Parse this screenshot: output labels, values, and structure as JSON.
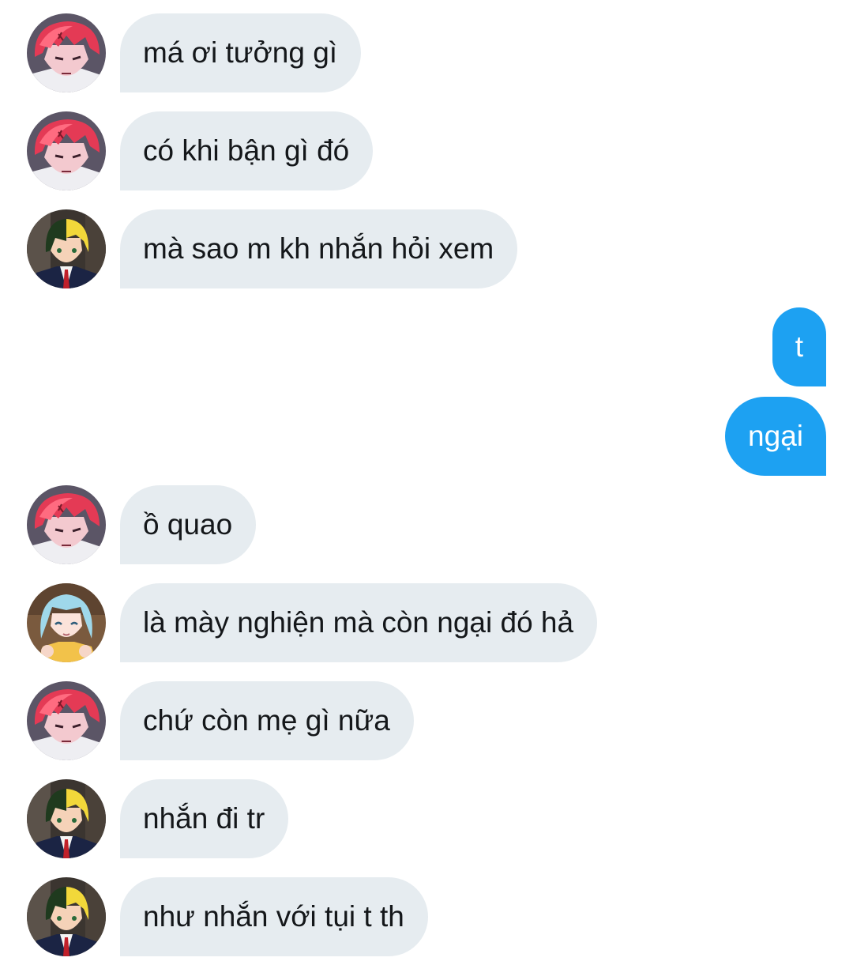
{
  "conversation": {
    "messages": [
      {
        "sender": "red-hair",
        "text": "má ơi tưởng gì"
      },
      {
        "sender": "red-hair",
        "text": "có khi bận gì đó"
      },
      {
        "sender": "green-yellow-hair",
        "text": "mà sao m kh nhắn hỏi xem"
      },
      {
        "sender": "me",
        "text": "t"
      },
      {
        "sender": "me",
        "text": "ngại"
      },
      {
        "sender": "red-hair",
        "text": "ồ quao"
      },
      {
        "sender": "blue-hair",
        "text": "là mày nghiện mà còn ngại đó hả"
      },
      {
        "sender": "red-hair",
        "text": "chứ còn mẹ gì nữa"
      },
      {
        "sender": "green-yellow-hair",
        "text": "nhắn đi tr"
      },
      {
        "sender": "green-yellow-hair",
        "text": "như nhắn với tụi t th"
      }
    ]
  },
  "colors": {
    "received_bubble": "#e6ecf0",
    "sent_bubble": "#1da1f2",
    "received_text": "#14171a",
    "sent_text": "#ffffff"
  },
  "icons": {
    "red-hair": "anime-red-hair-avatar",
    "green-yellow-hair": "anime-green-yellow-hair-avatar",
    "blue-hair": "anime-blue-hair-avatar"
  }
}
